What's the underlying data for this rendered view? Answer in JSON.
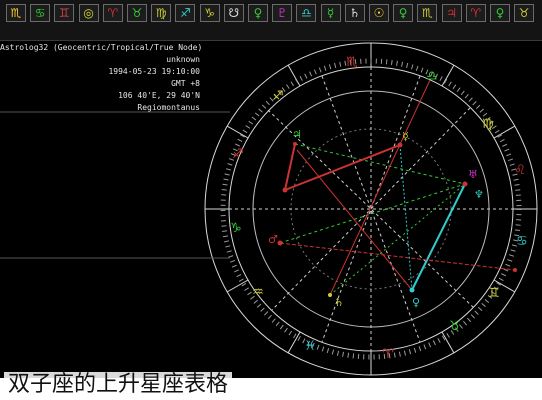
{
  "toolbar": {
    "buttons": [
      {
        "glyph": "♏",
        "label": "",
        "color": "#ffcc33"
      },
      {
        "glyph": "♋",
        "label": "",
        "color": "#33cc33"
      },
      {
        "glyph": "♊",
        "label": "",
        "color": "#cc4444"
      },
      {
        "glyph": "◎",
        "label": "",
        "color": "#dddd33"
      },
      {
        "glyph": "♈",
        "label": "",
        "color": "#cc3333"
      },
      {
        "glyph": "♉",
        "label": "",
        "color": "#33cc33"
      },
      {
        "glyph": "♍",
        "label": "",
        "color": "#cccc33"
      },
      {
        "glyph": "♐",
        "label": "",
        "color": "#33cccc"
      },
      {
        "glyph": "♑",
        "label": "",
        "color": "#cccc33"
      },
      {
        "glyph": "☋",
        "label": "",
        "color": "#dddddd"
      },
      {
        "glyph": "♀",
        "label": "",
        "color": "#33cc33"
      },
      {
        "glyph": "♇",
        "label": "",
        "color": "#cc33cc"
      },
      {
        "glyph": "♎",
        "label": "",
        "color": "#33cccc"
      },
      {
        "glyph": "☿",
        "label": "",
        "color": "#33cc33"
      },
      {
        "glyph": "♄",
        "label": "",
        "color": "#dddddd"
      },
      {
        "glyph": "☉",
        "label": "",
        "color": "#ffcc33"
      },
      {
        "glyph": "♀",
        "label": "",
        "color": "#33cc33"
      },
      {
        "glyph": "♏",
        "label": "",
        "color": "#cccc33"
      },
      {
        "glyph": "♃",
        "label": "",
        "color": "#cc3333"
      },
      {
        "glyph": "♈",
        "label": "",
        "color": "#cc3333"
      },
      {
        "glyph": "♀",
        "label": "",
        "color": "#33cc33"
      },
      {
        "glyph": "♉",
        "label": "",
        "color": "#cccc33"
      }
    ]
  },
  "left_panel": {
    "header_lines": [
      "Astrolog32 (Geocentric/Tropical/True Node)",
      "unknown",
      "1994-05-23 19:10:00",
      "GMT +8",
      "106 40'E, 29 40'N",
      "Regiomontanus"
    ]
  },
  "caption": "双子座的上升星座表格",
  "colors": {
    "accent_cyan": "#33cccc",
    "accent_red": "#cc3333",
    "accent_green": "#33cc33",
    "accent_yellow": "#cccc33",
    "accent_magenta": "#cc33cc",
    "wheel": "#d8d8d8",
    "caption_text": "#111111"
  }
}
